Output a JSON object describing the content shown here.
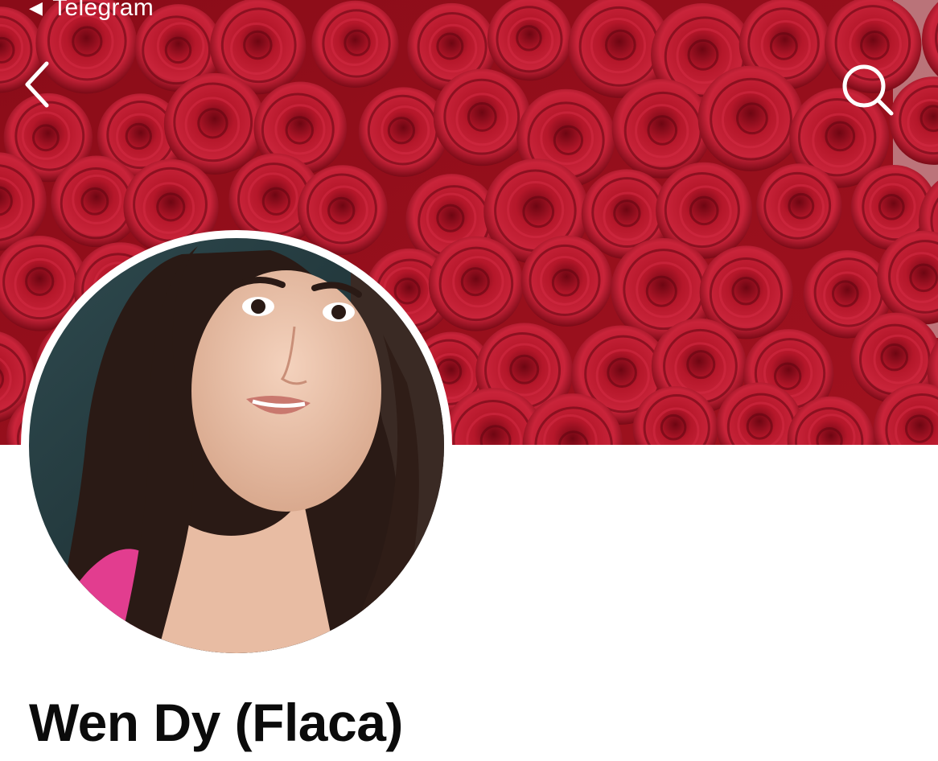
{
  "status_bar": {
    "back_app_label": "Telegram"
  },
  "header": {
    "back_icon": "chevron-left-icon",
    "search_icon": "search-icon"
  },
  "cover": {
    "description_color": "#a3121f"
  },
  "profile": {
    "name": "Wen Dy (Flaca)"
  },
  "colors": {
    "cover_red": "#a3121f",
    "text": "#0b0b0b",
    "background": "#ffffff"
  }
}
